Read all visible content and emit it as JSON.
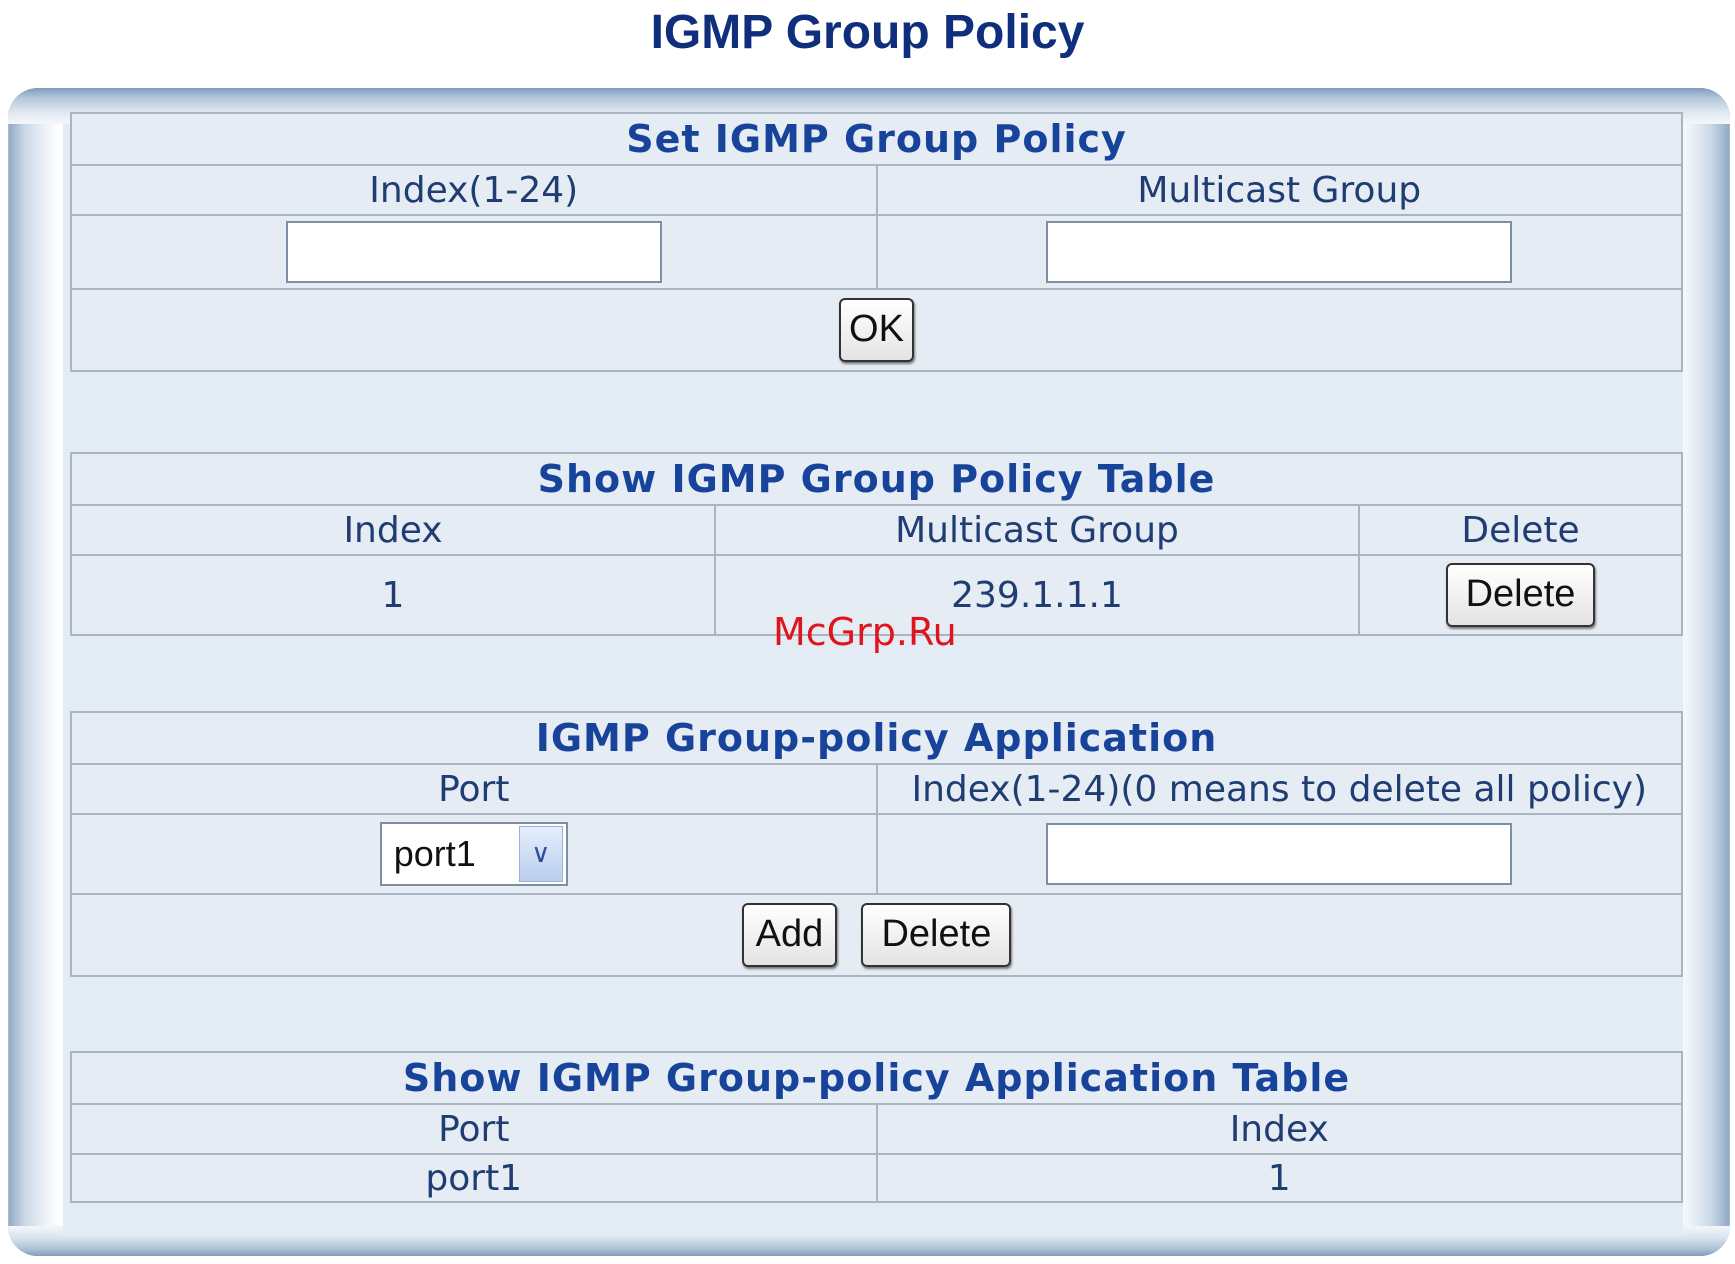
{
  "page": {
    "title": "IGMP Group Policy"
  },
  "set_policy": {
    "header": "Set IGMP Group Policy",
    "col_index": "Index(1-24)",
    "col_group": "Multicast Group",
    "index_value": "",
    "group_value": "",
    "ok_label": "OK"
  },
  "policy_table": {
    "header": "Show IGMP Group Policy Table",
    "columns": [
      "Index",
      "Multicast Group",
      "Delete"
    ],
    "rows": [
      {
        "index": "1",
        "group": "239.1.1.1",
        "delete_label": "Delete"
      }
    ]
  },
  "application": {
    "header": "IGMP Group-policy Application",
    "col_port": "Port",
    "col_index": "Index(1-24)(0 means to delete all policy)",
    "port_selected": "port1",
    "index_value": "",
    "add_label": "Add",
    "delete_label": "Delete"
  },
  "app_table": {
    "header": "Show IGMP Group-policy Application Table",
    "columns": [
      "Port",
      "Index"
    ],
    "rows": [
      {
        "port": "port1",
        "index": "1"
      }
    ]
  },
  "icons": {
    "select_arrow": "chevron-down-icon"
  },
  "watermark": "McGrp.Ru",
  "colors": {
    "title": "#0f2f7c",
    "header_text": "#17449a",
    "watermark": "#e0141c"
  }
}
